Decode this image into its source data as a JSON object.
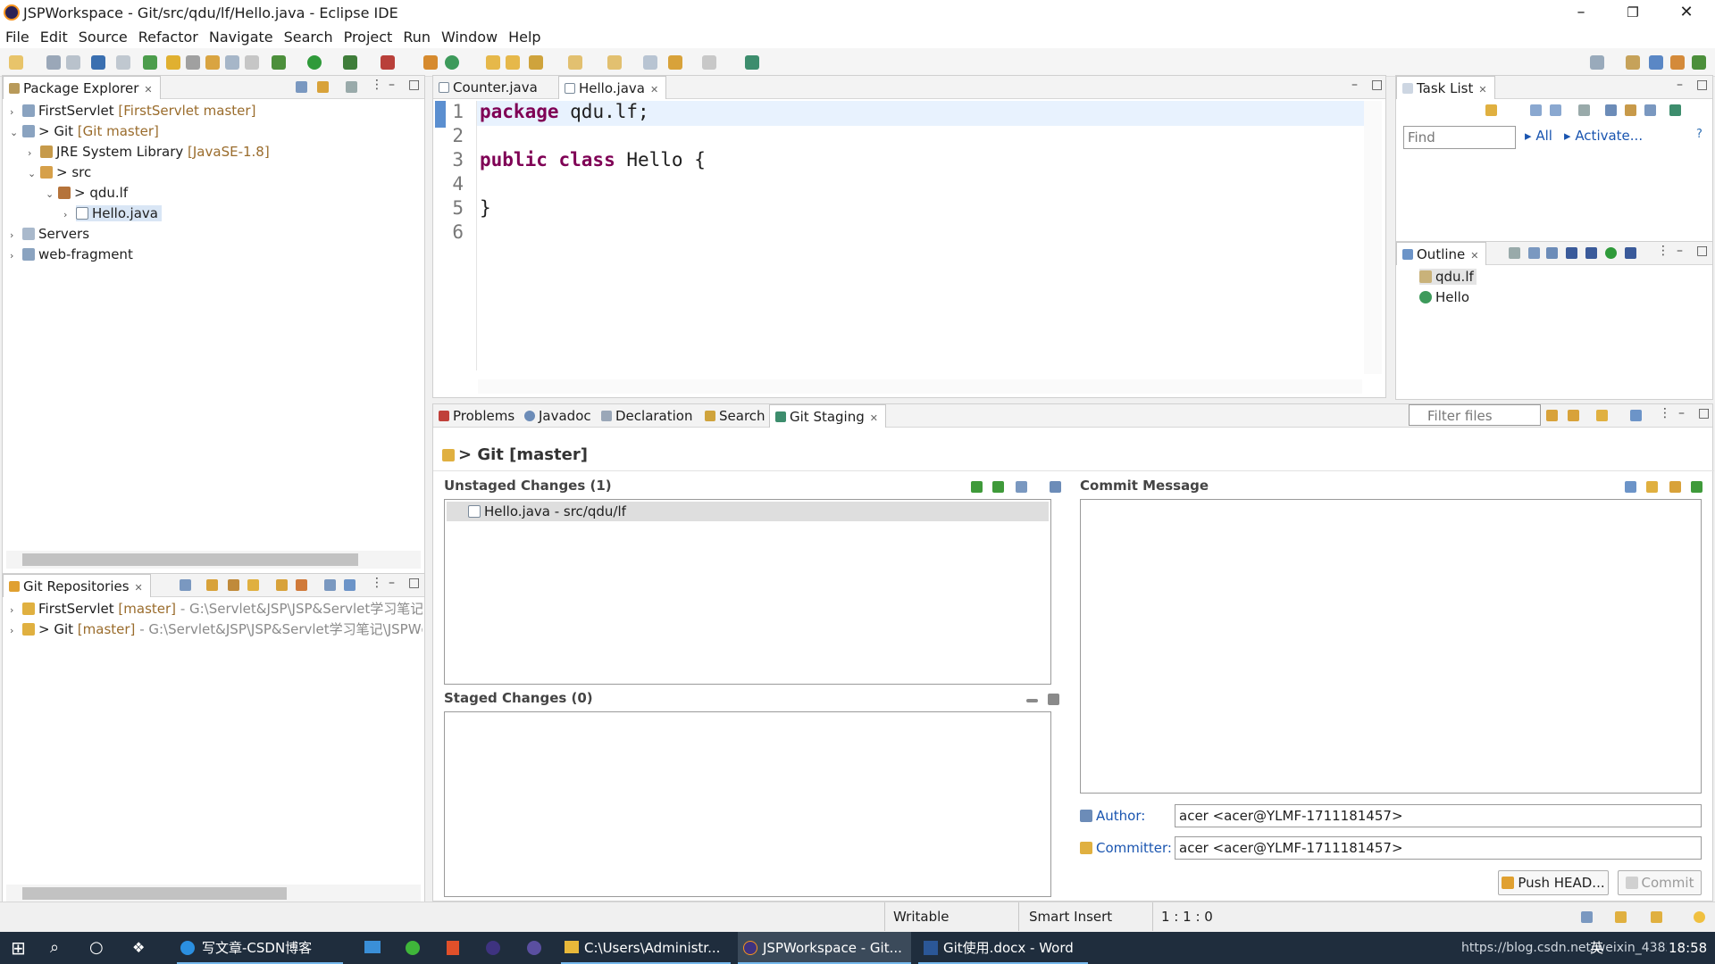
{
  "window": {
    "title": "JSPWorkspace - Git/src/qdu/lf/Hello.java - Eclipse IDE",
    "min": "–",
    "restore": "❐",
    "close": "✕"
  },
  "menu": [
    "File",
    "Edit",
    "Source",
    "Refactor",
    "Navigate",
    "Search",
    "Project",
    "Run",
    "Window",
    "Help"
  ],
  "package_explorer": {
    "title": "Package Explorer",
    "rows": [
      {
        "arrow": "›",
        "label": "FirstServlet",
        "deco": "[FirstServlet master]"
      },
      {
        "arrow": "⌄",
        "label": "> Git",
        "deco": "[Git master]"
      },
      {
        "arrow": "›",
        "label": "JRE System Library",
        "deco": "[JavaSE-1.8]"
      },
      {
        "arrow": "⌄",
        "label": "> src",
        "deco": ""
      },
      {
        "arrow": "⌄",
        "label": "> qdu.lf",
        "deco": ""
      },
      {
        "arrow": "›",
        "label": "Hello.java",
        "deco": ""
      },
      {
        "arrow": "›",
        "label": "Servers",
        "deco": ""
      },
      {
        "arrow": "›",
        "label": "web-fragment",
        "deco": ""
      }
    ]
  },
  "git_repos": {
    "title": "Git Repositories",
    "rows": [
      {
        "label": "FirstServlet",
        "branch": "[master]",
        "path": "- G:\\Servlet&JSP\\JSP&Servlet学习笔记\\"
      },
      {
        "label": "> Git",
        "branch": "[master]",
        "path": "- G:\\Servlet&JSP\\JSP&Servlet学习笔记\\JSPWc"
      }
    ]
  },
  "editor": {
    "tabs": [
      "Counter.java",
      "Hello.java"
    ],
    "lines": [
      {
        "n": "1",
        "kw": "package",
        "rest": " qdu.lf;"
      },
      {
        "n": "2",
        "kw": "",
        "rest": ""
      },
      {
        "n": "3",
        "kw": "public class",
        "rest": " Hello {"
      },
      {
        "n": "4",
        "kw": "",
        "rest": ""
      },
      {
        "n": "5",
        "kw": "",
        "rest": "}"
      },
      {
        "n": "6",
        "kw": "",
        "rest": ""
      }
    ]
  },
  "task_list": {
    "title": "Task List",
    "find_placeholder": "Find",
    "all": "All",
    "activate": "Activate..."
  },
  "outline": {
    "title": "Outline",
    "items": [
      "qdu.lf",
      "Hello"
    ]
  },
  "bottom_tabs": [
    "Problems",
    "Javadoc",
    "Declaration",
    "Search",
    "Git Staging"
  ],
  "git_staging": {
    "header": "> Git [master]",
    "filter_placeholder": "Filter files",
    "unstaged_title": "Unstaged Changes (1)",
    "unstaged_items": [
      "Hello.java - src/qdu/lf"
    ],
    "staged_title": "Staged Changes (0)",
    "commit_title": "Commit Message",
    "author_label": "Author:",
    "author_value": "acer <acer@YLMF-1711181457>",
    "committer_label": "Committer:",
    "committer_value": "acer <acer@YLMF-1711181457>",
    "push_button": "Push HEAD...",
    "commit_button": "Commit"
  },
  "status": {
    "writable": "Writable",
    "insert": "Smart Insert",
    "position": "1 : 1 : 0"
  },
  "taskbar": {
    "items": [
      "写文章-CSDN博客",
      "C:\\Users\\Administr...",
      "JSPWorkspace - Git...",
      "Git使用.docx - Word"
    ],
    "tray_text": "https://blog.csdn.net/weixin_43838",
    "clock": "18:58",
    "ime": "英"
  },
  "colors": {
    "accent": "#2f6fb4",
    "keyword": "#7f0055",
    "decoration": "#9a6c2c",
    "taskbar": "#1f2d3d"
  }
}
